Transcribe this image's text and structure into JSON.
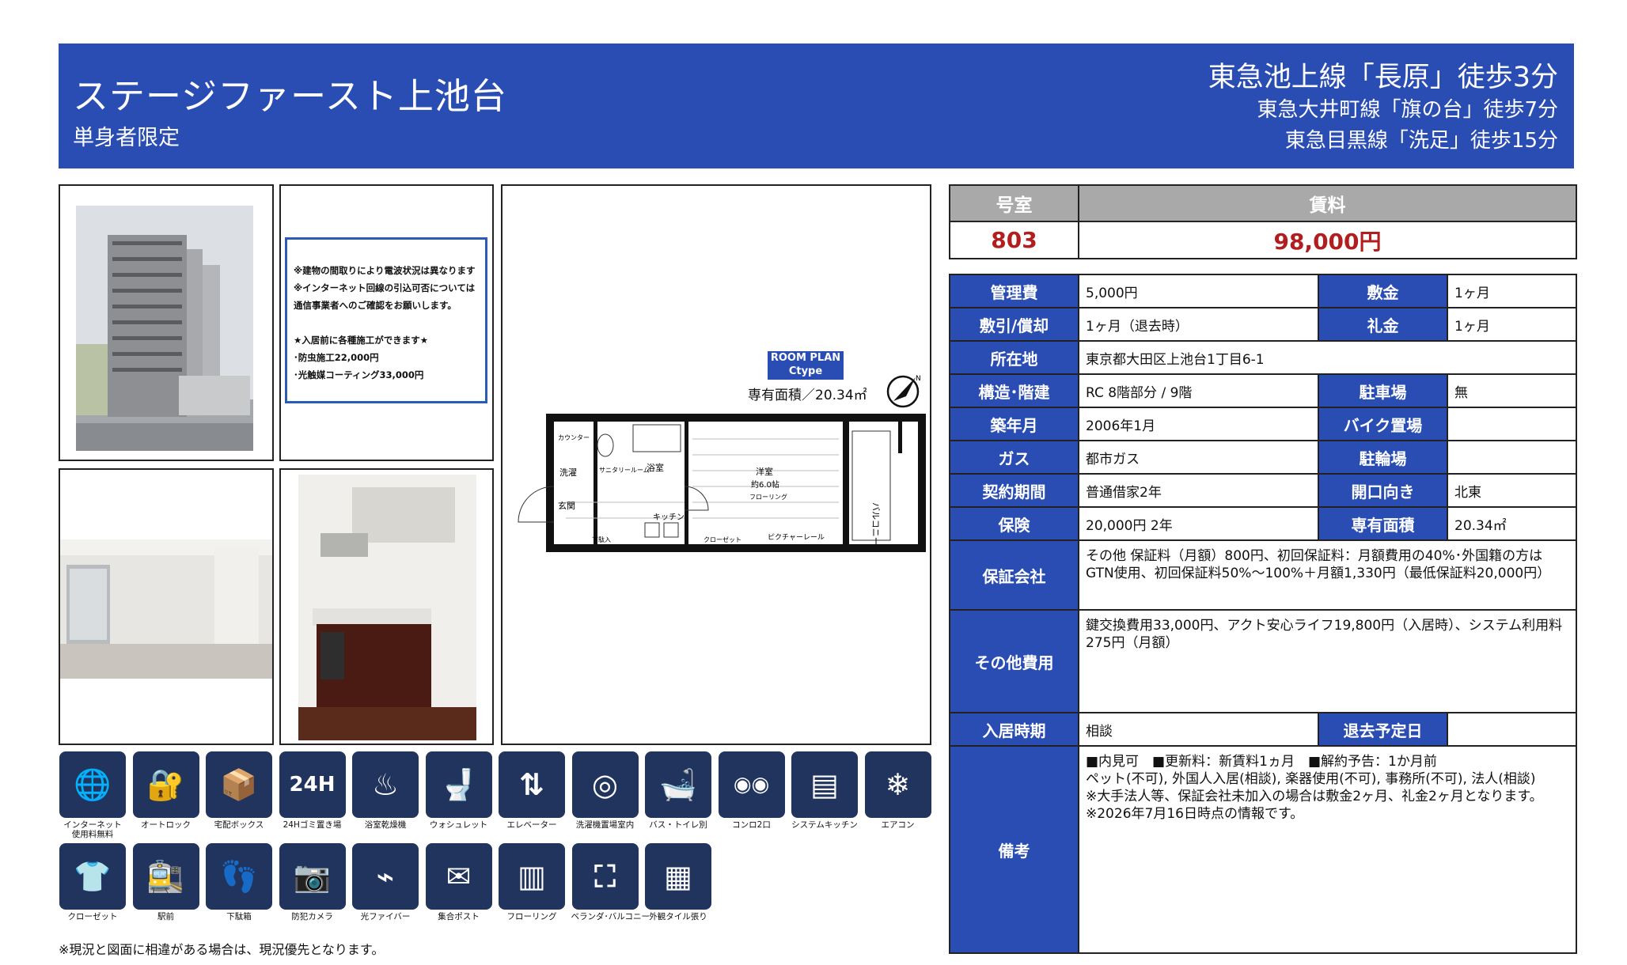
{
  "header": {
    "title": "ステージファースト上池台",
    "subtitle": "単身者限定",
    "station_main": "東急池上線「長原」徒歩3分",
    "station_2": "東急大井町線「旗の台」徒歩7分",
    "station_3": "東急目黒線「洗足」徒歩15分"
  },
  "notice": {
    "lines": [
      "※建物の間取りにより電波状況は異なります",
      "※インターネット回線の引込可否については",
      "通信事業者へのご確認をお願いします。",
      "",
      "★入居前に各種施工ができます★",
      "･防虫施工22,000円",
      "･光触媒コーティング33,000円"
    ]
  },
  "floorplan": {
    "badge_line1": "ROOM PLAN",
    "badge_line2": "Ctype",
    "area_label": "専有面積／20.34㎡",
    "rooms": {
      "counter": "カウンター",
      "wash": "洗濯",
      "sanitary": "サニタリールーム",
      "bath": "浴室",
      "western": "洋室",
      "western_size": "約6.0帖",
      "flooring": "フローリング",
      "balcony": "バルコニー",
      "entrance": "玄関",
      "shoebox": "下駄入",
      "kitchen": "キッチン",
      "closet": "クローゼット",
      "picture_rail": "ピクチャーレール"
    }
  },
  "summary": {
    "room_label": "号室",
    "rent_label": "賃料",
    "room": "803",
    "rent": "98,000円"
  },
  "details": {
    "mgmt_label": "管理費",
    "mgmt": "5,000円",
    "deposit_label": "敷金",
    "deposit": "1ヶ月",
    "shikibiki_label": "敷引/償却",
    "shikibiki": "1ヶ月（退去時）",
    "key_money_label": "礼金",
    "key_money": "1ヶ月",
    "address_label": "所在地",
    "address": "東京都大田区上池台1丁目6-1",
    "structure_label": "構造･階建",
    "structure": "RC 8階部分 / 9階",
    "parking_label": "駐車場",
    "parking": "無",
    "built_label": "築年月",
    "built": "2006年1月",
    "bike_label": "バイク置場",
    "bike": "",
    "gas_label": "ガス",
    "gas": "都市ガス",
    "bicycle_label": "駐輪場",
    "bicycle": "",
    "contract_label": "契約期間",
    "contract": "普通借家2年",
    "direction_label": "開口向き",
    "direction": "北東",
    "insurance_label": "保険",
    "insurance": "20,000円 2年",
    "area_label": "専有面積",
    "area": "20.34㎡",
    "guarantor_label": "保証会社",
    "guarantor": "その他 保証料（月額）800円、初回保証料：月額費用の40%･外国籍の方はGTN使用、初回保証料50%～100%＋月額1,330円（最低保証料20,000円）",
    "other_fees_label": "その他費用",
    "other_fees": "鍵交換費用33,000円、アクト安心ライフ19,800円（入居時）、システム利用料275円（月額）",
    "move_in_label": "入居時期",
    "move_in": "相談",
    "move_out_label": "退去予定日",
    "move_out": "",
    "remarks_label": "備考",
    "remarks": [
      "■内見可　■更新料：新賃料1ヵ月　■解約予告：1か月前",
      "ペット(不可), 外国人入居(相談), 楽器使用(不可), 事務所(不可), 法人(相談)",
      "※大手法人等、保証会社未加入の場合は敷金2ヶ月、礼金2ヶ月となります。",
      "※2026年7月16日時点の情報です。"
    ]
  },
  "amenities": [
    {
      "label": "インターネット\n使用料無料",
      "icon": "internet-icon"
    },
    {
      "label": "オートロック",
      "icon": "autolock-icon"
    },
    {
      "label": "宅配ボックス",
      "icon": "delivery-box-icon"
    },
    {
      "label": "24Hゴミ置き場",
      "icon": "garbage-24h-icon"
    },
    {
      "label": "浴室乾燥機",
      "icon": "bath-dryer-icon"
    },
    {
      "label": "ウォシュレット",
      "icon": "washlet-icon"
    },
    {
      "label": "エレベーター",
      "icon": "elevator-icon"
    },
    {
      "label": "洗濯機置場室内",
      "icon": "washing-machine-icon"
    },
    {
      "label": "バス・トイレ別",
      "icon": "bath-toilet-icon"
    },
    {
      "label": "コンロ2口",
      "icon": "stove-icon"
    },
    {
      "label": "システムキッチン",
      "icon": "system-kitchen-icon"
    },
    {
      "label": "エアコン",
      "icon": "aircon-icon"
    },
    {
      "label": "クローゼット",
      "icon": "closet-icon"
    },
    {
      "label": "駅前",
      "icon": "station-icon"
    },
    {
      "label": "下駄箱",
      "icon": "shoe-box-icon"
    },
    {
      "label": "防犯カメラ",
      "icon": "security-camera-icon"
    },
    {
      "label": "光ファイバー",
      "icon": "fiber-icon"
    },
    {
      "label": "集合ポスト",
      "icon": "mailbox-icon"
    },
    {
      "label": "フローリング",
      "icon": "flooring-icon"
    },
    {
      "label": "ベランダ･バルコニー",
      "icon": "balcony-icon"
    },
    {
      "label": "外観タイル張り",
      "icon": "tile-icon"
    }
  ],
  "footnote": "※現況と図面に相違がある場合は、現況優先となります。"
}
